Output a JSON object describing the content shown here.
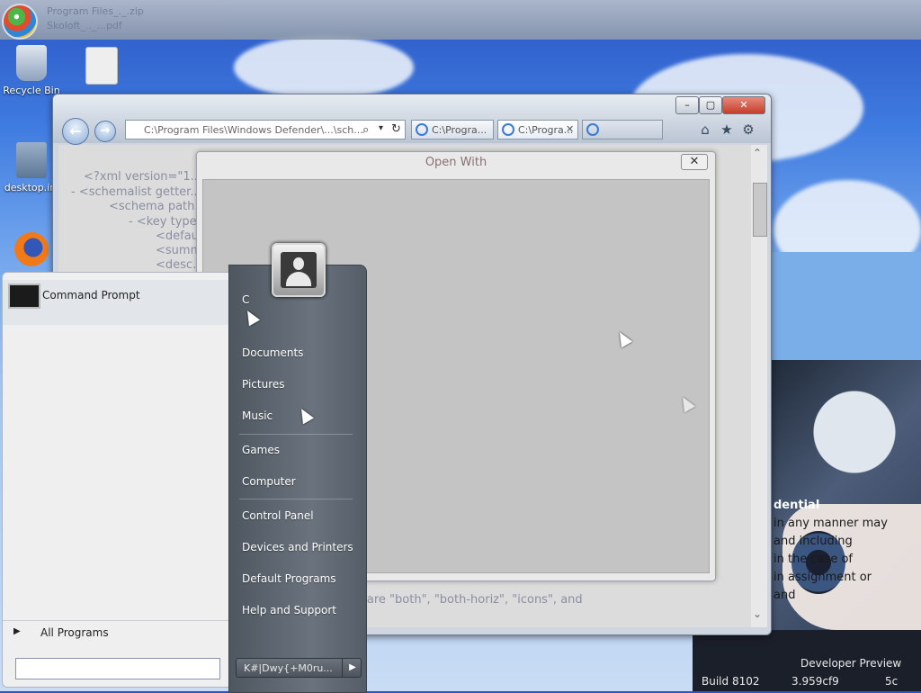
{
  "taskbar_top": {
    "ghost_line1": "Program Files_._.zip",
    "ghost_line2": "Skoloft_.._...pdf"
  },
  "desktop": {
    "icons": [
      {
        "label": "Recycle Bin",
        "icon": "recycle-bin-icon"
      },
      {
        "label": "",
        "icon": "file-icon"
      },
      {
        "label": "desktop.ini",
        "icon": "settings-file-icon"
      },
      {
        "label": "",
        "icon": "firefox-icon"
      }
    ]
  },
  "ie": {
    "address": "C:\\Program Files\\Windows Defender\\...\\sch...",
    "tabs": [
      {
        "label": "C:\\Progra..."
      },
      {
        "label": "C:\\Progra..."
      },
      {
        "label": ""
      }
    ],
    "controls": {
      "minimize": "–",
      "maximize": "▢",
      "close": "✕"
    },
    "content_lines": [
      "<?xml version=\"1...",
      "- <schemalist getter...",
      "<schema path...",
      "- <key type...",
      "<defau...",
      "<summ...",
      "<desc...",
      "Possible values are \"both\", \"both-horiz\", \"icons\", and"
    ]
  },
  "open_with": {
    "title": "Open With",
    "close": "✕"
  },
  "start_menu": {
    "pinned": [
      {
        "label": "Command Prompt"
      }
    ],
    "all_programs": "All Programs",
    "search_placeholder": "",
    "user_initial": "C",
    "right_items": [
      {
        "label": "Documents"
      },
      {
        "label": "Pictures"
      },
      {
        "label": "Music"
      },
      {
        "label": "Games"
      },
      {
        "label": "Computer"
      },
      {
        "label": "Control Panel"
      },
      {
        "label": "Devices and Printers"
      },
      {
        "label": "Default Programs"
      },
      {
        "label": "Help and Support"
      }
    ],
    "shutdown_label": "K#|Dwy{+M0ru..."
  },
  "wallpaper_text": {
    "heading": "dential",
    "lines": [
      "in any manner may",
      "and including",
      "in the case of",
      "in assignment or",
      "and"
    ],
    "corner_line1": "Developer Preview",
    "corner_line2": "3.959cf9",
    "corner_line3": "Build 8102",
    "corner_line4": "5c"
  }
}
